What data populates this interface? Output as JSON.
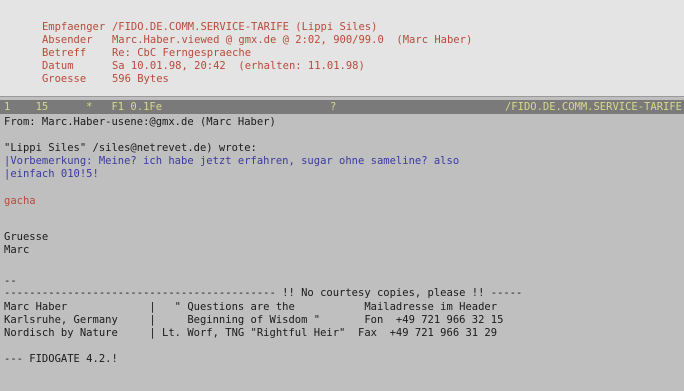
{
  "header": {
    "rows": [
      {
        "label": "Empfaenger",
        "value": "/FIDO.DE.COMM.SERVICE-TARIFE (Lippi Siles)"
      },
      {
        "label": "Absender",
        "value": "Marc.Haber.viewed @ gmx.de @ 2:02, 900/99.0  (Marc Haber)"
      },
      {
        "label": "Betreff",
        "value": "Re: CbC Ferngespraeche"
      },
      {
        "label": "Datum",
        "value": "Sa 10.01.98, 20:42  (erhalten: 11.01.98)"
      },
      {
        "label": "Groesse",
        "value": "596 Bytes"
      }
    ]
  },
  "status": {
    "left": "1    15      *   F1 0.1Fe",
    "mid": "?",
    "right": "/FIDO.DE.COMM.SERVICE-TARIFE"
  },
  "message": {
    "from_line": "From: Marc.Haber-usene:@gmx.de (Marc Haber)",
    "quote_intro": "\"Lippi Siles\" /siles@netrevet.de) wrote:",
    "quote_line1": "|Vorbemerkung: Meine? ich habe jetzt erfahren, sugar ohne sameline? also",
    "quote_line2": "|einfach 010!5!",
    "reply": "gacha",
    "greeting": "Gruesse",
    "name": "Marc",
    "sig_sep": "--",
    "sig_banner": "------------------------------------------- !! No courtesy copies, please !! -----",
    "sig_row1": "Marc Haber             |   \" Questions are the           Mailadresse im Header",
    "sig_row2": "Karlsruhe, Germany     |     Beginning of Wisdom \"       Fon  +49 721 966 32 15",
    "sig_row3": "Nordisch by Nature     | Lt. Worf, TNG \"Rightful Heir\"  Fax  +49 721 966 31 29",
    "tearline": "--- FIDOGATE 4.2.!"
  }
}
